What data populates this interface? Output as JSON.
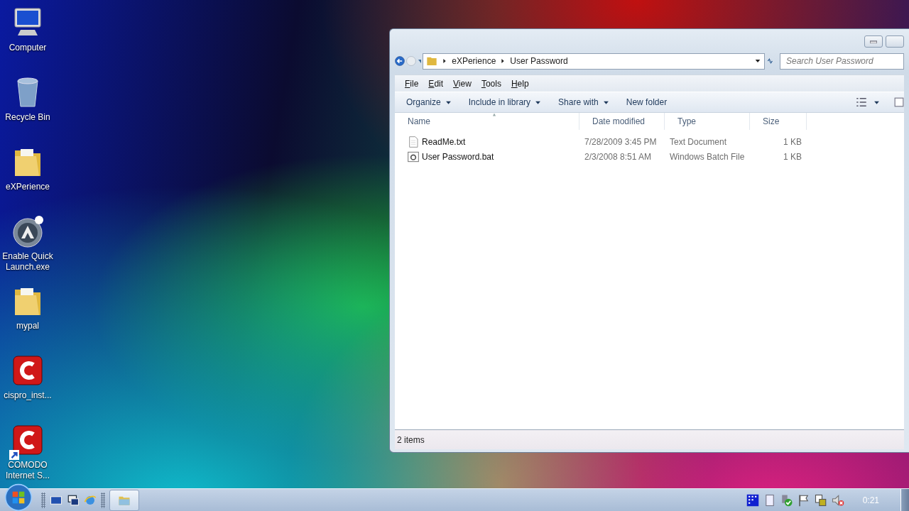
{
  "desktop_icons": [
    {
      "label": "Computer",
      "kind": "computer",
      "shortcut": false
    },
    {
      "label": "Recycle Bin",
      "kind": "bin",
      "shortcut": false
    },
    {
      "label": "eXPerience",
      "kind": "folder",
      "shortcut": false
    },
    {
      "label": "Enable Quick Launch.exe",
      "kind": "app",
      "shortcut": false
    },
    {
      "label": "mypal",
      "kind": "folder",
      "shortcut": false
    },
    {
      "label": "cispro_inst...",
      "kind": "comodo",
      "shortcut": false
    },
    {
      "label": "COMODO Internet S...",
      "kind": "comodo",
      "shortcut": true
    }
  ],
  "window": {
    "address": [
      "eXPerience",
      "User Password"
    ],
    "search": {
      "placeholder": "Search User Password"
    },
    "menu": [
      "File",
      "Edit",
      "View",
      "Tools",
      "Help"
    ],
    "toolbar": [
      {
        "label": "Organize",
        "dropdown": true
      },
      {
        "label": "Include in library",
        "dropdown": true
      },
      {
        "label": "Share with",
        "dropdown": true
      },
      {
        "label": "New folder",
        "dropdown": false
      }
    ],
    "columns": [
      {
        "label": "Name",
        "sorted": true
      },
      {
        "label": "Date modified",
        "sorted": false
      },
      {
        "label": "Type",
        "sorted": false
      },
      {
        "label": "Size",
        "sorted": false
      }
    ],
    "rows": [
      {
        "kind": "text",
        "name": "ReadMe.txt",
        "date": "7/28/2009 3:45 PM",
        "type": "Text Document",
        "size": "1 KB"
      },
      {
        "kind": "batch",
        "name": "User Password.bat",
        "date": "2/3/2008 8:51 AM",
        "type": "Windows Batch File",
        "size": "1 KB"
      }
    ],
    "status": "2 items"
  },
  "taskbar": {
    "quick_launch": [
      {
        "kind": "desktop"
      },
      {
        "kind": "switch"
      },
      {
        "kind": "browser"
      }
    ],
    "windows": [
      {
        "kind": "folder",
        "selected": true
      }
    ],
    "tray": [
      {
        "kind": "grid"
      },
      {
        "kind": "doc"
      },
      {
        "kind": "check"
      },
      {
        "kind": "flag"
      },
      {
        "kind": "network"
      },
      {
        "kind": "mute"
      }
    ],
    "clock": "0:21"
  }
}
